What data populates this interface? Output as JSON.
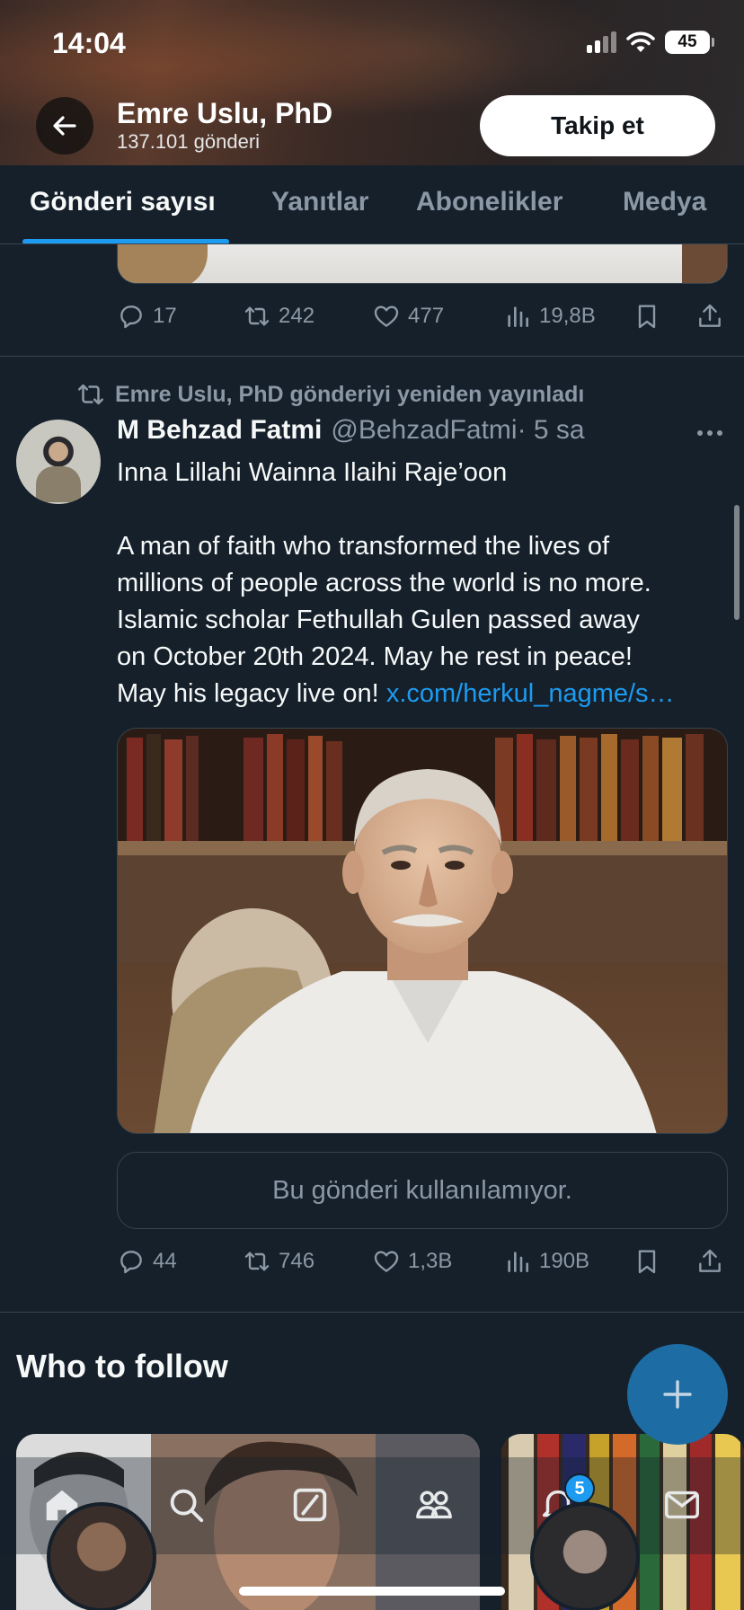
{
  "status_bar": {
    "time": "14:04",
    "battery": "45"
  },
  "header": {
    "profile_name": "Emre Uslu, PhD",
    "post_count": "137.101 gönderi",
    "follow_label": "Takip et"
  },
  "tabs": [
    {
      "label": "Gönderi sayısı",
      "active": true
    },
    {
      "label": "Yanıtlar",
      "active": false
    },
    {
      "label": "Abonelikler",
      "active": false
    },
    {
      "label": "Medya",
      "active": false
    }
  ],
  "previous_post": {
    "replies": "17",
    "reposts": "242",
    "likes": "477",
    "views": "19,8B"
  },
  "post": {
    "repost_context": "Emre Uslu, PhD gönderiyi yeniden yayınladı",
    "author_name": "M Behzad Fatmi",
    "author_handle": "@BehzadFatmi",
    "time": " · 5 sa",
    "text_lines": [
      "Inna Lillahi Wainna Ilaihi Raje’oon",
      "",
      "A man of faith who transformed the lives of",
      "millions of people across the world is no more.",
      "Islamic scholar Fethullah Gulen passed away",
      "on October 20th 2024. May he rest in peace!",
      "May his legacy live on! "
    ],
    "link": "x.com/herkul_nagme/s…",
    "unavailable_notice": "Bu gönderi kullanılamıyor.",
    "replies": "44",
    "reposts": "746",
    "likes": "1,3B",
    "views": "190B"
  },
  "who_to_follow": {
    "title": "Who to follow"
  },
  "bottom_nav": {
    "notification_count": "5"
  },
  "colors": {
    "background": "#15202b",
    "accent": "#1d9bf0",
    "muted": "#8b98a5",
    "border": "#38444d"
  }
}
